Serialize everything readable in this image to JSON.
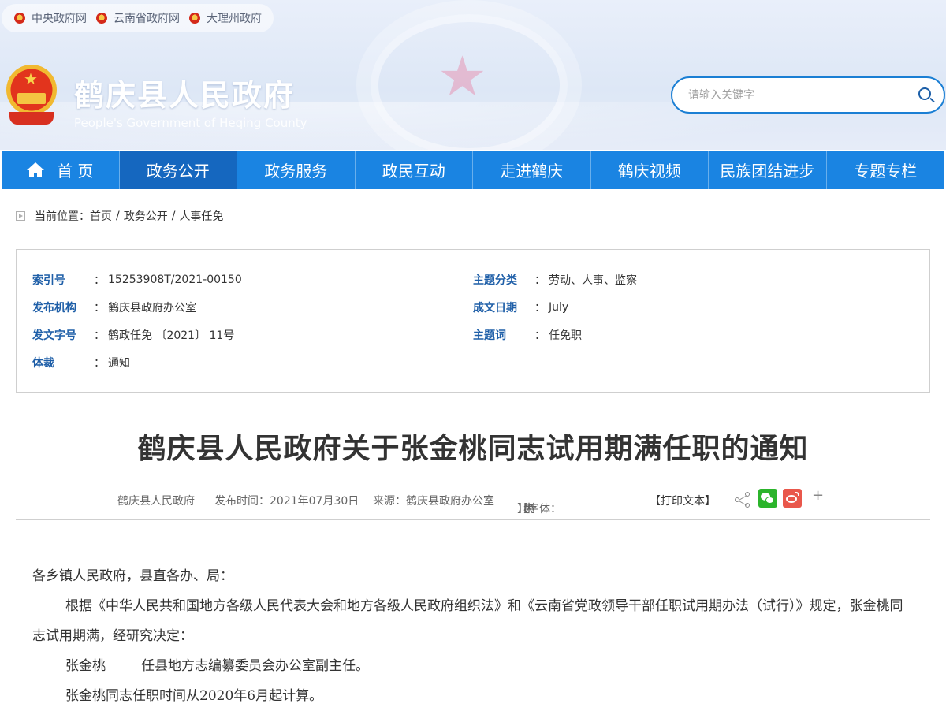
{
  "top_links": [
    {
      "label": "中央政府网"
    },
    {
      "label": "云南省政府网"
    },
    {
      "label": "大理州政府"
    }
  ],
  "site": {
    "title_cn": "鹤庆县人民政府",
    "title_en": "People's Government of Heqing County"
  },
  "search": {
    "placeholder": "请输入关键字",
    "value": ""
  },
  "nav": {
    "items": [
      {
        "label": "首 页"
      },
      {
        "label": "政务公开"
      },
      {
        "label": "政务服务"
      },
      {
        "label": "政民互动"
      },
      {
        "label": "走进鹤庆"
      },
      {
        "label": "鹤庆视频"
      },
      {
        "label": "民族团结进步"
      },
      {
        "label": "专题专栏"
      }
    ],
    "active_index": 1
  },
  "breadcrumb": {
    "prefix": "当前位置：",
    "items": [
      "首页",
      "政务公开",
      "人事任免"
    ],
    "separator": "/"
  },
  "meta": {
    "colon": "：",
    "left": [
      {
        "label": "索引号",
        "value": "15253908T/2021-00150"
      },
      {
        "label": "发布机构",
        "value": "鹤庆县政府办公室"
      },
      {
        "label": "发文字号",
        "value": "鹤政任免 〔2021〕 11号"
      },
      {
        "label": "体裁",
        "value": "通知"
      }
    ],
    "right": [
      {
        "label": "主题分类",
        "value": "劳动、人事、监察"
      },
      {
        "label": "成文日期",
        "value": "July"
      },
      {
        "label": "主题词",
        "value": "任免职"
      }
    ]
  },
  "document": {
    "title": "鹤庆县人民政府关于张金桃同志试用期满任职的通知",
    "publisher": "鹤庆县人民政府",
    "publish_time": "发布时间：2021年07月30日",
    "source": "来源：鹤庆县政府办公室",
    "font_prefix": "【字体：",
    "font_large": "大",
    "font_medium": "中",
    "font_small": "小",
    "font_suffix": "】",
    "print": "【打印文本】",
    "body": {
      "salutation": "各乡镇人民政府，县直各办、局：",
      "paragraph1": "根据《中华人民共和国地方各级人民代表大会和地方各级人民政府组织法》和《云南省党政领导干部任职试用期办法（试行）》规定，张金桃同志试用期满，经研究决定：",
      "appoint_name": "张金桃",
      "appoint_post": "任县地方志编纂委员会办公室副主任。",
      "paragraph2": "张金桃同志任职时间从2020年6月起计算。"
    }
  },
  "colors": {
    "nav_bg": "#1a84e2",
    "nav_active": "#1567bf",
    "label_blue": "#1f5fa8",
    "wechat_green": "#2bb42b",
    "weibo_red": "#e9574b"
  }
}
